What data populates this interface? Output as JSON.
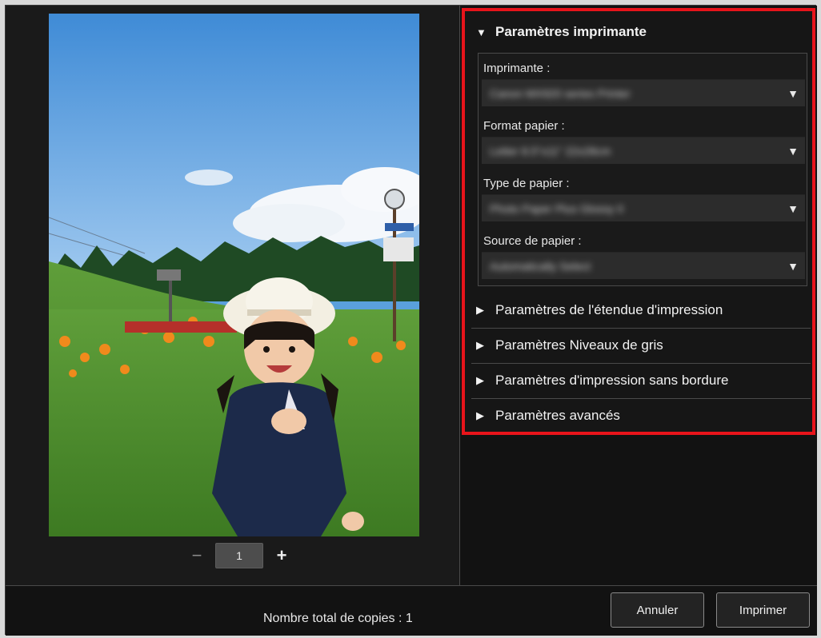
{
  "preview": {
    "page_number": "1",
    "minus_label": "−",
    "plus_label": "+"
  },
  "settings": {
    "printer_section": {
      "title": "Paramètres imprimante",
      "fields": [
        {
          "label": "Imprimante :",
          "value": "Canon MX920 series Printer"
        },
        {
          "label": "Format papier :",
          "value": "Letter 8.5\"x11\" 22x28cm"
        },
        {
          "label": "Type de papier :",
          "value": "Photo Paper Plus Glossy II"
        },
        {
          "label": "Source de papier :",
          "value": "Automatically Select"
        }
      ]
    },
    "collapsed_sections": [
      "Paramètres de l'étendue d'impression",
      "Paramètres Niveaux de gris",
      "Paramètres d'impression sans bordure",
      "Paramètres avancés"
    ]
  },
  "footer": {
    "total_copies": "Nombre total de copies : 1",
    "cancel_label": "Annuler",
    "print_label": "Imprimer"
  },
  "colors": {
    "highlight": "#e8141b",
    "background": "#121212"
  }
}
